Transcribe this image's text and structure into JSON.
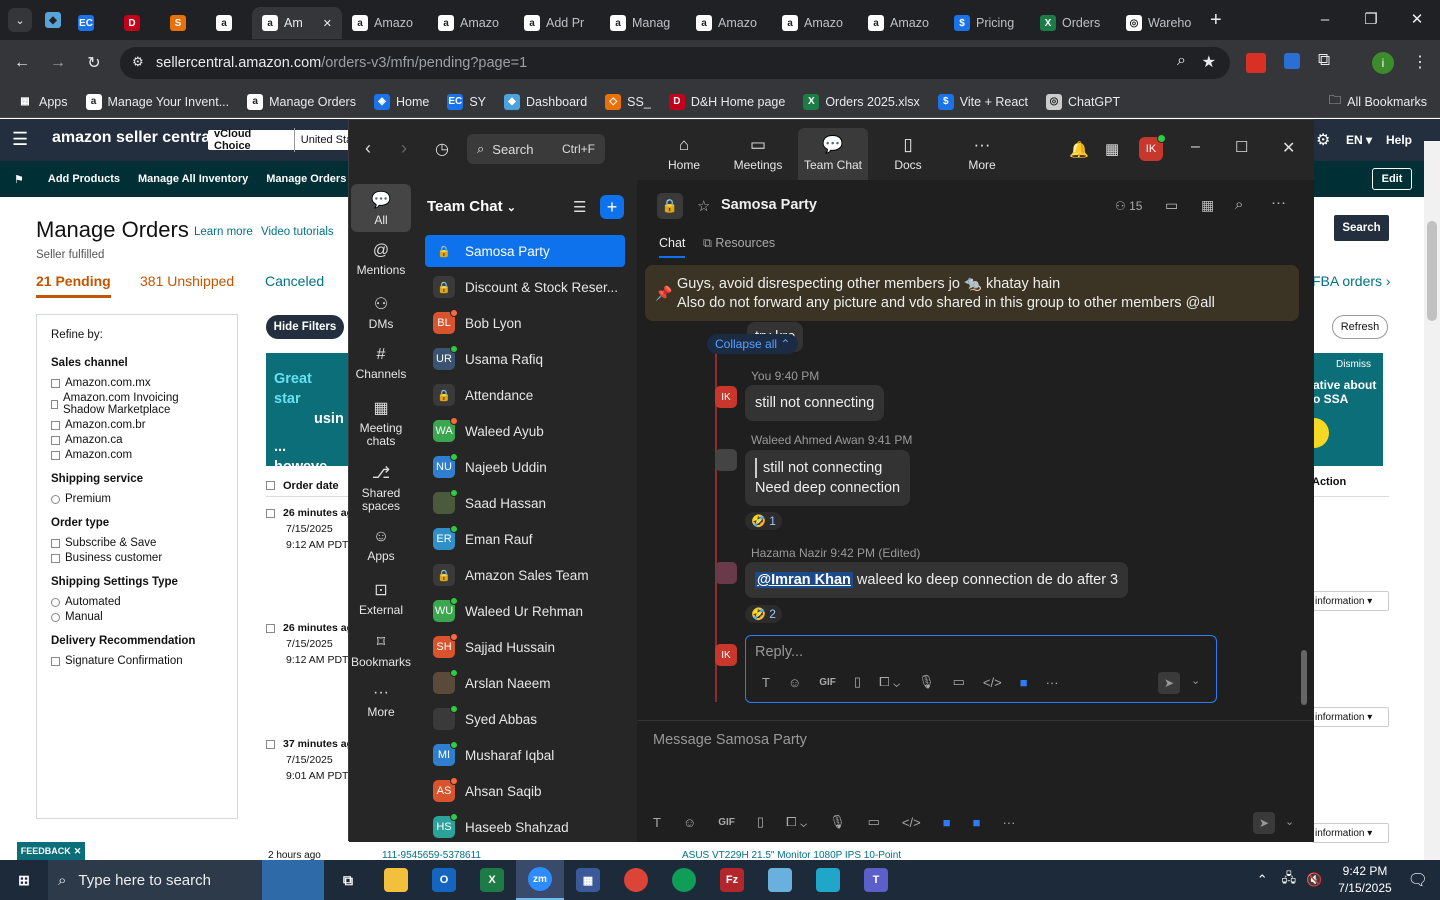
{
  "browser": {
    "tabs": [
      {
        "label": "",
        "fav": "EC",
        "color": "#1a73e8"
      },
      {
        "label": "",
        "fav": "D",
        "color": "#c4001a"
      },
      {
        "label": "",
        "fav": "S",
        "color": "#e8710a"
      },
      {
        "label": "",
        "fav": "a",
        "color": "#ffffff"
      },
      {
        "label": "Am",
        "fav": "a",
        "color": "#ffffff",
        "active": true
      },
      {
        "label": "Amazo",
        "fav": "a",
        "color": "#ffffff"
      },
      {
        "label": "Amazo",
        "fav": "a",
        "color": "#ffffff"
      },
      {
        "label": "Add Pr",
        "fav": "a",
        "color": "#ffffff"
      },
      {
        "label": "Manag",
        "fav": "a",
        "color": "#ffffff"
      },
      {
        "label": "Amazo",
        "fav": "a",
        "color": "#ffffff"
      },
      {
        "label": "Amazo",
        "fav": "a",
        "color": "#ffffff"
      },
      {
        "label": "Amazo",
        "fav": "a",
        "color": "#ffffff"
      },
      {
        "label": "Pricing",
        "fav": "$",
        "color": "#1a73e8"
      },
      {
        "label": "Orders",
        "fav": "X",
        "color": "#1d7b45"
      },
      {
        "label": "Wareho",
        "fav": "◎",
        "color": "#ffffff"
      }
    ],
    "url_host": "sellercentral.amazon.com",
    "url_path": "/orders-v3/mfn/pending?page=1",
    "bookmarks": [
      "Apps",
      "Manage Your Invent...",
      "Manage Orders",
      "Home",
      "SY",
      "Dashboard",
      "SS_",
      "D&H Home page",
      "Orders 2025.xlsx",
      "Vite + React",
      "ChatGPT"
    ],
    "all_bookmarks": "All Bookmarks"
  },
  "amazon": {
    "logo": "amazon seller central",
    "vcloud": "vCloud Choice",
    "store": "United Sta",
    "lang": "EN",
    "help": "Help",
    "nav": [
      "Add Products",
      "Manage All Inventory",
      "Manage Orders",
      "Acc"
    ],
    "edit": "Edit",
    "title": "Manage Orders",
    "learn_more": "Learn more",
    "video": "Video tutorials",
    "seller_fulfilled": "Seller fulfilled",
    "tabs": [
      "21 Pending",
      "381 Unshipped",
      "Canceled"
    ],
    "fba": "FBA orders",
    "refine": "Refine by:",
    "sales_channel": "Sales channel",
    "channels": [
      "Amazon.com.mx",
      "Amazon.com Invoicing Shadow Marketplace",
      "Amazon.com.br",
      "Amazon.ca",
      "Amazon.com"
    ],
    "shipping_service": "Shipping service",
    "premium": "Premium",
    "order_type": "Order type",
    "order_types": [
      "Subscribe & Save",
      "Business customer"
    ],
    "ship_settings": "Shipping Settings Type",
    "ship_opts": [
      "Automated",
      "Manual"
    ],
    "delivery": "Delivery Recommendation",
    "signature": "Signature Confirmation",
    "hide_filters": "Hide Filters",
    "search": "Search",
    "refresh": "Refresh",
    "banner_l1": "Great star",
    "banner_l2": "usin",
    "banner_l3": "... howeve",
    "dismiss": "Dismiss",
    "banner_r1": "ative about",
    "banner_r2": "o SSA",
    "order_date": "Order date",
    "action": "Action",
    "orders": [
      {
        "ago": "26 minutes ag",
        "date": "7/15/2025",
        "time": "9:12 AM PDT"
      },
      {
        "ago": "26 minutes ag",
        "date": "7/15/2025",
        "time": "9:12 AM PDT"
      },
      {
        "ago": "37 minutes ag",
        "date": "7/15/2025",
        "time": "9:01 AM PDT"
      }
    ],
    "info": "information",
    "bottom_row": "2 hours ago",
    "bottom_order": "111-9545659-5378611",
    "bottom_product": "ASUS VT229H 21.5\" Monitor 1080P IPS 10-Point",
    "feedback": "FEEDBACK"
  },
  "zoom": {
    "search": "Search",
    "search_shortcut": "Ctrl+F",
    "top_nav": [
      "Home",
      "Meetings",
      "Team Chat",
      "Docs",
      "More"
    ],
    "user_initials": "IK",
    "side": [
      "All",
      "Mentions",
      "DMs",
      "Channels",
      "Meeting chats",
      "Shared spaces",
      "Apps",
      "External",
      "Bookmarks",
      "More"
    ],
    "list_title": "Team Chat",
    "channels": [
      {
        "name": "Samosa Party",
        "type": "lock",
        "sel": true
      },
      {
        "name": "Discount & Stock Reser...",
        "type": "lock"
      },
      {
        "name": "Bob Lyon",
        "init": "BL",
        "color": "#d9542c",
        "dot": "#ff6a3d"
      },
      {
        "name": "Usama Rafiq",
        "init": "UR",
        "color": "#3a5370",
        "dot": "#2ecc40"
      },
      {
        "name": "Attendance",
        "type": "lock"
      },
      {
        "name": "Waleed Ayub",
        "init": "WA",
        "color": "#3aa64d",
        "dot": "#ff6a3d"
      },
      {
        "name": "Najeeb Uddin",
        "init": "NU",
        "color": "#2f7fd1",
        "dot": "#2ecc40"
      },
      {
        "name": "Saad Hassan",
        "init": "",
        "color": "#4a5a3a",
        "dot": "#2ecc40"
      },
      {
        "name": "Eman Rauf",
        "init": "ER",
        "color": "#2f8fc9",
        "dot": "#2ecc40"
      },
      {
        "name": "Amazon Sales Team",
        "type": "lock"
      },
      {
        "name": "Waleed Ur Rehman",
        "init": "WU",
        "color": "#3aa64d",
        "dot": "#2ecc40"
      },
      {
        "name": "Sajjad Hussain",
        "init": "SH",
        "color": "#d9542c",
        "dot": "#ff6a3d"
      },
      {
        "name": "Arslan Naeem",
        "init": "",
        "color": "#5a4a3a",
        "dot": "#2ecc40"
      },
      {
        "name": "Syed Abbas",
        "init": "",
        "color": "#3a3a3a",
        "dot": "#2ecc40"
      },
      {
        "name": "Musharaf Iqbal",
        "init": "MI",
        "color": "#2f7fd1",
        "dot": "#2ecc40"
      },
      {
        "name": "Ahsan Saqib",
        "init": "AS",
        "color": "#d9542c",
        "dot": "#ff6a3d"
      },
      {
        "name": "Haseeb Shahzad",
        "init": "HS",
        "color": "#2aa39a",
        "dot": "#2ecc40"
      }
    ],
    "chat_title": "Samosa Party",
    "member_count": "15",
    "tab_chat": "Chat",
    "tab_resources": "Resources",
    "pinned_line1": "Guys, avoid disrespecting other members jo 🐀 khatay hain",
    "pinned_line2": "Also do not forward any picture and vdo shared in this group to other members @all",
    "partial_msg": "try kro",
    "collapse_all": "Collapse all",
    "m1_header": "You 9:40 PM",
    "m1_text": "still not connecting",
    "m2_header": "Waleed Ahmed Awan 9:41 PM",
    "m2_quote": "still not connecting",
    "m2_text": "Need deep connection",
    "m2_react_count": "1",
    "m3_header": "Hazama Nazir 9:42 PM (Edited)",
    "m3_mention": "@Imran Khan",
    "m3_text": " waleed ko deep connection de do after 3",
    "m3_react_count": "2",
    "reply_placeholder": "Reply...",
    "message_placeholder": "Message Samosa Party",
    "gif": "GIF"
  },
  "taskbar": {
    "search_placeholder": "Type here to search",
    "time": "9:42 PM",
    "date": "7/15/2025"
  }
}
